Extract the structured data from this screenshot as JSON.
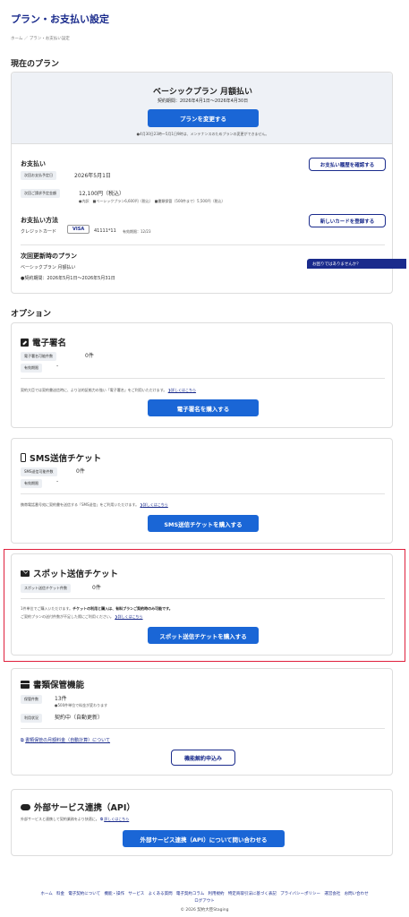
{
  "page": {
    "title": "プラン・お支払い設定",
    "breadcrumb": "ホーム ／ プラン・お支払い設定"
  },
  "current_plan": {
    "section_title": "現在のプラン",
    "plan_name": "ベーシックプラン 月額払い",
    "contract_period": "契約期間：2026年4月1日〜2026年4月30日",
    "change_button": "プランを変更する",
    "maintenance_note": "●4月30日23時〜5月1日9時は、メンテナンスのためプランの変更ができません。",
    "payment": {
      "title": "お支払い",
      "next_date_label": "次回お支払予定日",
      "next_date": "2026年5月1日",
      "next_amount_label": "次回ご請求予定金額",
      "next_amount": "12,100円（税込）",
      "breakdown": "●内訳　■ベーシックプラン6,600円（税込）　■書類保管（500件まで）5,500円（税込）",
      "history_button": "お支払い履歴を確認する"
    },
    "method": {
      "title": "お支払い方法",
      "type": "クレジットカード",
      "brand": "VISA",
      "number": "41111*11",
      "expiry": "有効期限：12/23",
      "register_button": "新しいカードを登録する"
    },
    "next_plan": {
      "title": "次回更新時のプラン",
      "name": "ベーシックプラン 月額払い",
      "period": "●契約期間：2026年5月1日〜2026年5月31日"
    },
    "help_tooltip": "お困りではありませんか？"
  },
  "options": {
    "section_title": "オプション",
    "esign": {
      "title": "電子署名",
      "count_label": "電子署名可能件数",
      "count": "0件",
      "expiry_label": "有効期限",
      "expiry": "-",
      "desc": "契約大臣では契約書送信時に、より法的証拠力の強い「電子署名」をご利用いただけます。",
      "link": "詳しくはこちら",
      "button": "電子署名を購入する"
    },
    "sms": {
      "title": "SMS送信チケット",
      "count_label": "SMS送信可能件数",
      "count": "0件",
      "expiry_label": "有効期限",
      "expiry": "-",
      "desc": "携帯電話番号宛に契約書を送信する「SMS送信」をご利用いただけます。",
      "link": "詳しくはこちら",
      "button": "SMS送信チケットを購入する"
    },
    "spot": {
      "title": "スポット送信チケット",
      "count_label": "スポット送信チケット件数",
      "count": "0件",
      "desc1": "1件単位でご購入いただけます。",
      "desc1_bold": "チケットの利用と購入は、有料プランご契約時のみ可能です。",
      "desc2": "ご契約プランの送付件数が不足した際にご利用ください。",
      "link": "詳しくはこちら",
      "button": "スポット送信チケットを購入する"
    },
    "storage": {
      "title": "書類保管機能",
      "count_label": "保管件数",
      "count": "13件",
      "count_note": "●500件単位で料金が変わります",
      "status_label": "利用状況",
      "status": "契約中（自動更新）",
      "fee_link": "書類保管の月額料金（自動計算）について",
      "cancel_button": "機能解約申込み"
    },
    "api": {
      "title": "外部サービス連携（API）",
      "desc": "外部サービスと連携して契約業務をより快適に。",
      "link": "詳しくはこちら",
      "button": "外部サービス連携（API）について問い合わせる"
    }
  },
  "footer": {
    "links": [
      "ホーム",
      "料金",
      "電子契約について",
      "機能・操作",
      "サービス",
      "よくある質問",
      "電子契約コラム",
      "利用規約",
      "特定商取引法に基づく表記",
      "プライバシーポリシー",
      "運営会社",
      "お問い合わせ"
    ],
    "logout": "ログアウト",
    "copyright": "© 2026 契約大臣Staging"
  },
  "colors": {
    "brand": "#1a2b8c",
    "primary_button": "#1a66d6",
    "highlight": "#e0203c"
  }
}
